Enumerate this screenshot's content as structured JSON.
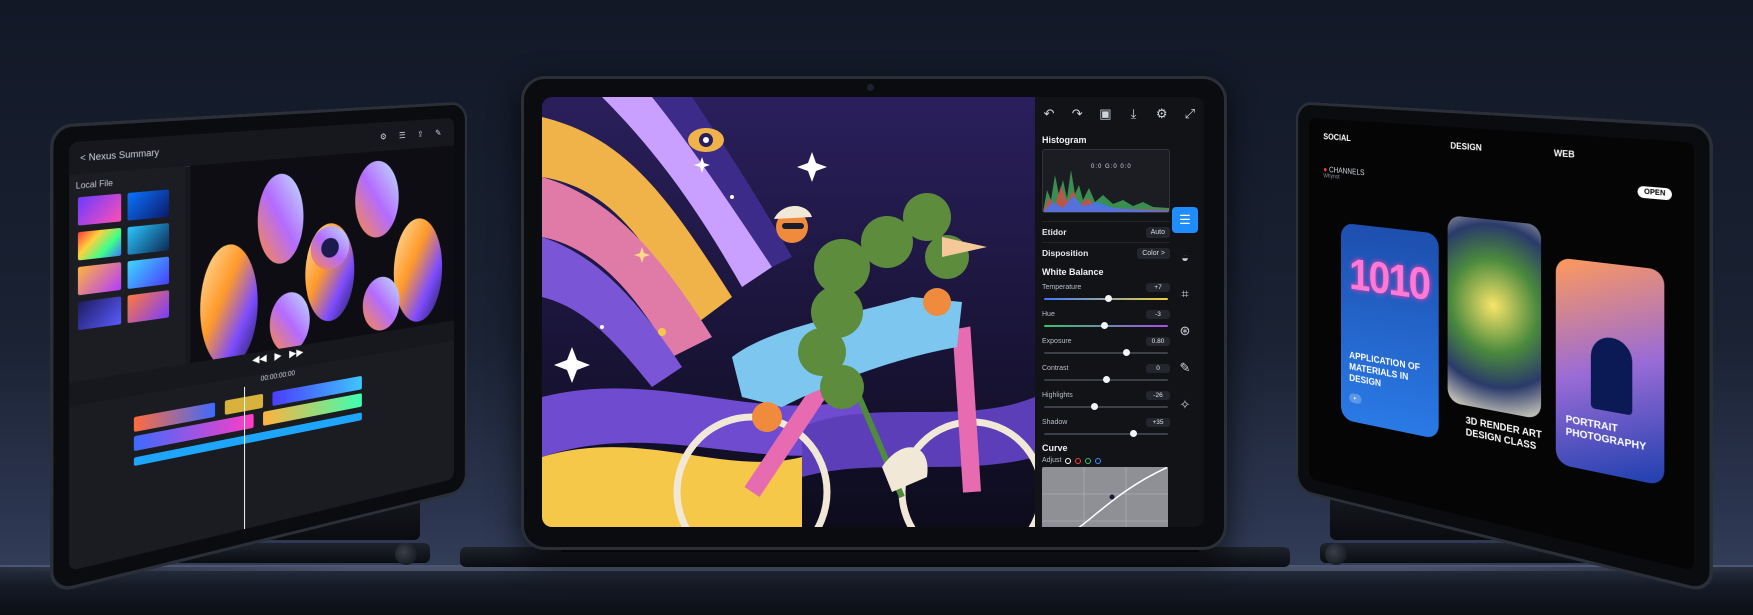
{
  "center_tablet": {
    "toolbar_icons": [
      "undo-icon",
      "redo-icon",
      "folder-icon",
      "download-icon",
      "settings-icon",
      "expand-icon"
    ],
    "panel": {
      "histogram_title": "Histogram",
      "histogram_readout": "0:0   G:0   0:0",
      "editor_label": "Etidor",
      "editor_value": "Auto",
      "disposition_label": "Disposition",
      "disposition_value": "Color >",
      "white_balance_title": "White Balance",
      "sliders": [
        {
          "label": "Temperature",
          "value": "+7",
          "position": 0.52
        },
        {
          "label": "Hue",
          "value": "-3",
          "position": 0.48
        },
        {
          "label": "Exposure",
          "value": "0.80",
          "position": 0.66
        },
        {
          "label": "Contrast",
          "value": "0",
          "position": 0.5
        },
        {
          "label": "Highlights",
          "value": "-26",
          "position": 0.4
        },
        {
          "label": "Shadow",
          "value": "+35",
          "position": 0.72
        }
      ],
      "curve_title": "Curve",
      "curve_adjust_label": "Adjust",
      "curve_channel_colors": [
        "#ffffff",
        "#ff3b3b",
        "#35c46b",
        "#3f8cff"
      ]
    },
    "sidebar_icons": [
      "sliders-icon",
      "tone-icon",
      "crop-icon",
      "color-circles-icon",
      "brush-icon",
      "sparkle-icon"
    ],
    "accent_color": "#1f8cff"
  },
  "left_tablet": {
    "header_title": "< Nexus Summary",
    "library_label": "Local File",
    "timeline_label": "00:00:00:00"
  },
  "right_tablet": {
    "nav": [
      "SOCIAL",
      "DESIGN",
      "WEB"
    ],
    "channels_label": "CHANNELS",
    "channels_sub": "Whynot",
    "open_button": "OPEN",
    "cards": [
      {
        "title": "APPLICATION OF MATERIALS IN DESIGN",
        "art_text": "1010"
      },
      {
        "title": "3D RENDER ART DESIGN CLASS"
      },
      {
        "title": "PORTRAIT PHOTOGRAPHY"
      }
    ]
  }
}
